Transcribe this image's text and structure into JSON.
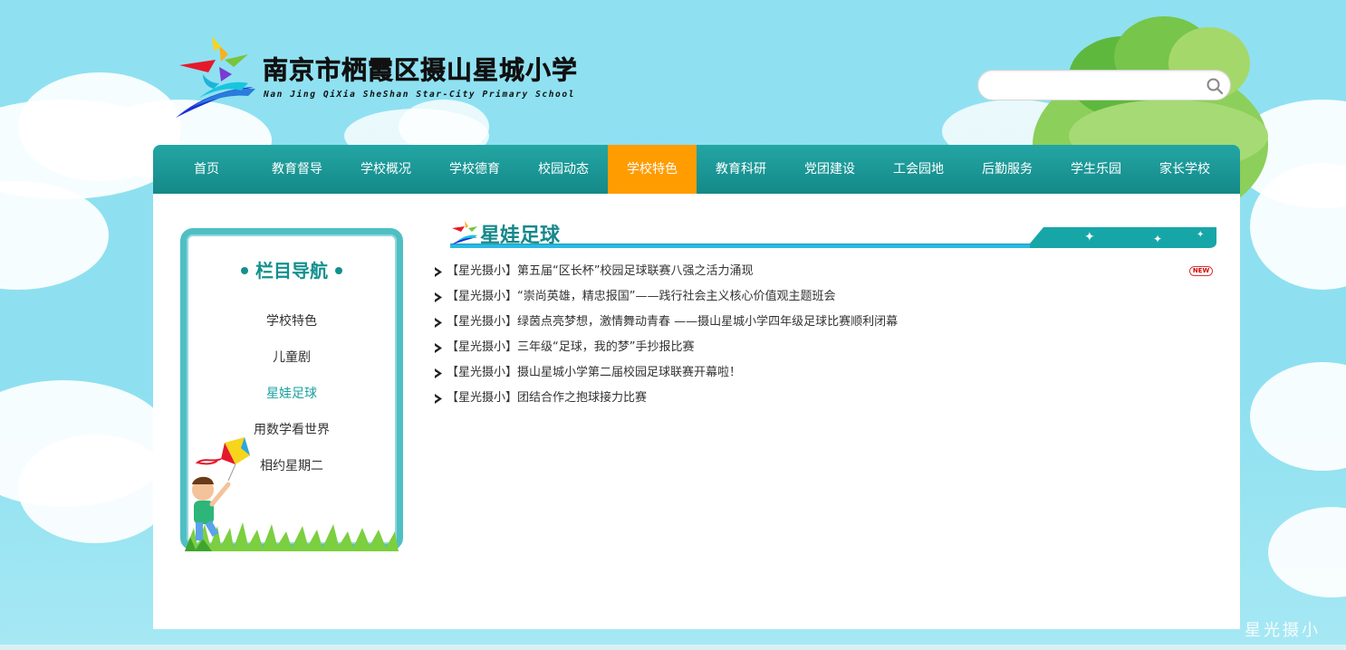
{
  "header": {
    "school_name_cn": "南京市栖霞区摄山星城小学",
    "school_name_en": "Nan Jing QiXia SheShan Star-City Primary School",
    "search": {
      "value": "",
      "placeholder": ""
    }
  },
  "nav": {
    "items": [
      {
        "label": "首页"
      },
      {
        "label": "教育督导"
      },
      {
        "label": "学校概况"
      },
      {
        "label": "学校德育"
      },
      {
        "label": "校园动态"
      },
      {
        "label": "学校特色",
        "active": true
      },
      {
        "label": "教育科研"
      },
      {
        "label": "党团建设"
      },
      {
        "label": "工会园地"
      },
      {
        "label": "后勤服务"
      },
      {
        "label": "学生乐园"
      },
      {
        "label": "家长学校"
      }
    ],
    "active_color": "#ff9c00",
    "bar_color": "#1a9896"
  },
  "sidebar": {
    "title": "栏目导航",
    "items": [
      {
        "label": "学校特色"
      },
      {
        "label": "儿童剧"
      },
      {
        "label": "星娃足球",
        "active": true
      },
      {
        "label": "用数学看世界"
      },
      {
        "label": "相约星期二"
      }
    ]
  },
  "section": {
    "title": "星娃足球",
    "articles": [
      {
        "title": "【星光摄小】第五届“区长杯”校园足球联赛八强之活力涌现",
        "badge": "NEW"
      },
      {
        "title": "【星光摄小】“崇尚英雄，精忠报国”——践行社会主义核心价值观主题班会"
      },
      {
        "title": "【星光摄小】绿茵点亮梦想，激情舞动青春 ——摄山星城小学四年级足球比赛顺利闭幕"
      },
      {
        "title": "【星光摄小】三年级“足球，我的梦”手抄报比赛"
      },
      {
        "title": "【星光摄小】摄山星城小学第二届校园足球联赛开幕啦！"
      },
      {
        "title": "【星光摄小】团结合作之抱球接力比赛"
      }
    ]
  },
  "watermark": "星光摄小",
  "icons": [
    "logo-icon",
    "search-icon",
    "chevron-right-icon",
    "new-badge-icon",
    "kid-with-kite-illustration"
  ]
}
